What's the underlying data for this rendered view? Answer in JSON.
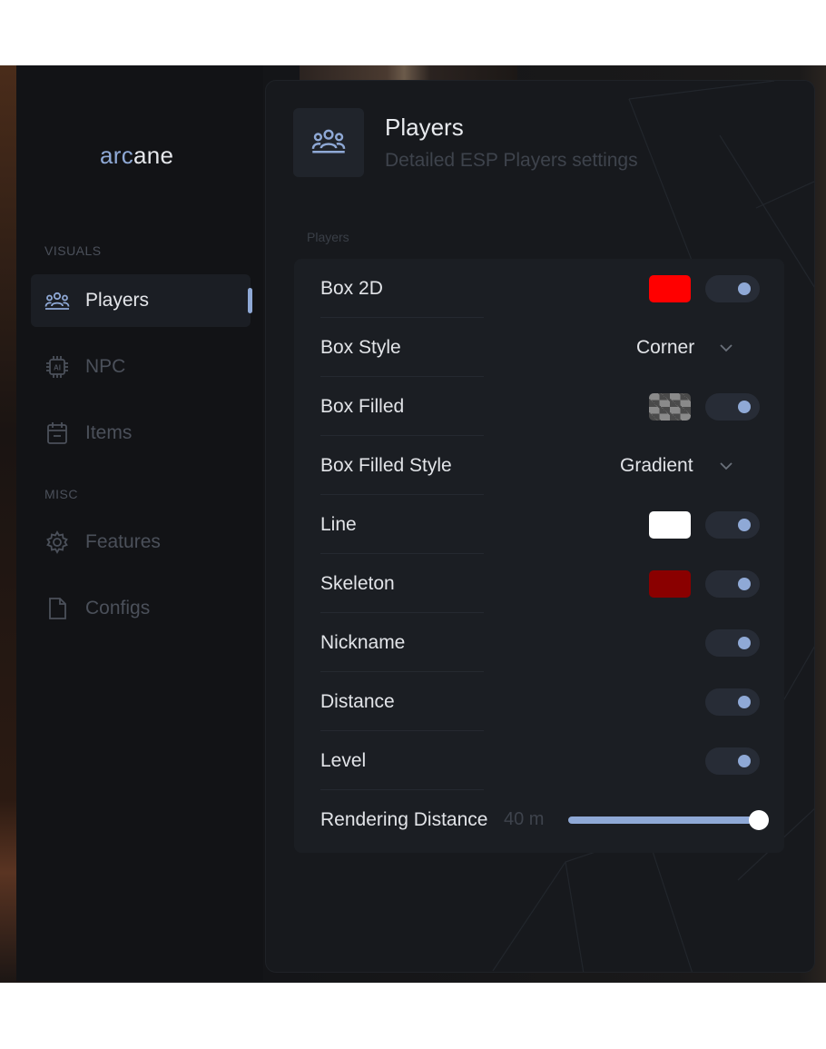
{
  "brand": {
    "part1": "arc",
    "part2": "ane"
  },
  "colors": {
    "accent": "#8fa9d6",
    "panel": "#17191d",
    "sidebar": "#121316"
  },
  "sidebar": {
    "sections": [
      {
        "label": "VISUALS"
      },
      {
        "label": "MISC"
      }
    ],
    "items": [
      {
        "label": "Players",
        "icon": "users-icon",
        "active": true
      },
      {
        "label": "NPC",
        "icon": "ai-chip-icon",
        "active": false
      },
      {
        "label": "Items",
        "icon": "calendar-icon",
        "active": false
      },
      {
        "label": "Features",
        "icon": "gear-icon",
        "active": false
      },
      {
        "label": "Configs",
        "icon": "file-icon",
        "active": false
      }
    ]
  },
  "header": {
    "title": "Players",
    "subtitle": "Detailed ESP Players settings",
    "icon": "users-icon"
  },
  "group": {
    "label": "Players",
    "rows": [
      {
        "label": "Box 2D",
        "type": "color-toggle",
        "color": "#ff0000",
        "enabled": true
      },
      {
        "label": "Box Style",
        "type": "select",
        "value": "Corner"
      },
      {
        "label": "Box Filled",
        "type": "color-toggle",
        "color": "checker",
        "enabled": true
      },
      {
        "label": "Box Filled Style",
        "type": "select",
        "value": "Gradient"
      },
      {
        "label": "Line",
        "type": "color-toggle",
        "color": "#ffffff",
        "enabled": true
      },
      {
        "label": "Skeleton",
        "type": "color-toggle",
        "color": "#8a0000",
        "enabled": true
      },
      {
        "label": "Nickname",
        "type": "toggle",
        "enabled": true
      },
      {
        "label": "Distance",
        "type": "toggle",
        "enabled": true
      },
      {
        "label": "Level",
        "type": "toggle",
        "enabled": true
      },
      {
        "label": "Rendering Distance",
        "type": "slider",
        "value_text": "40 m",
        "fraction": 1.0
      }
    ]
  }
}
